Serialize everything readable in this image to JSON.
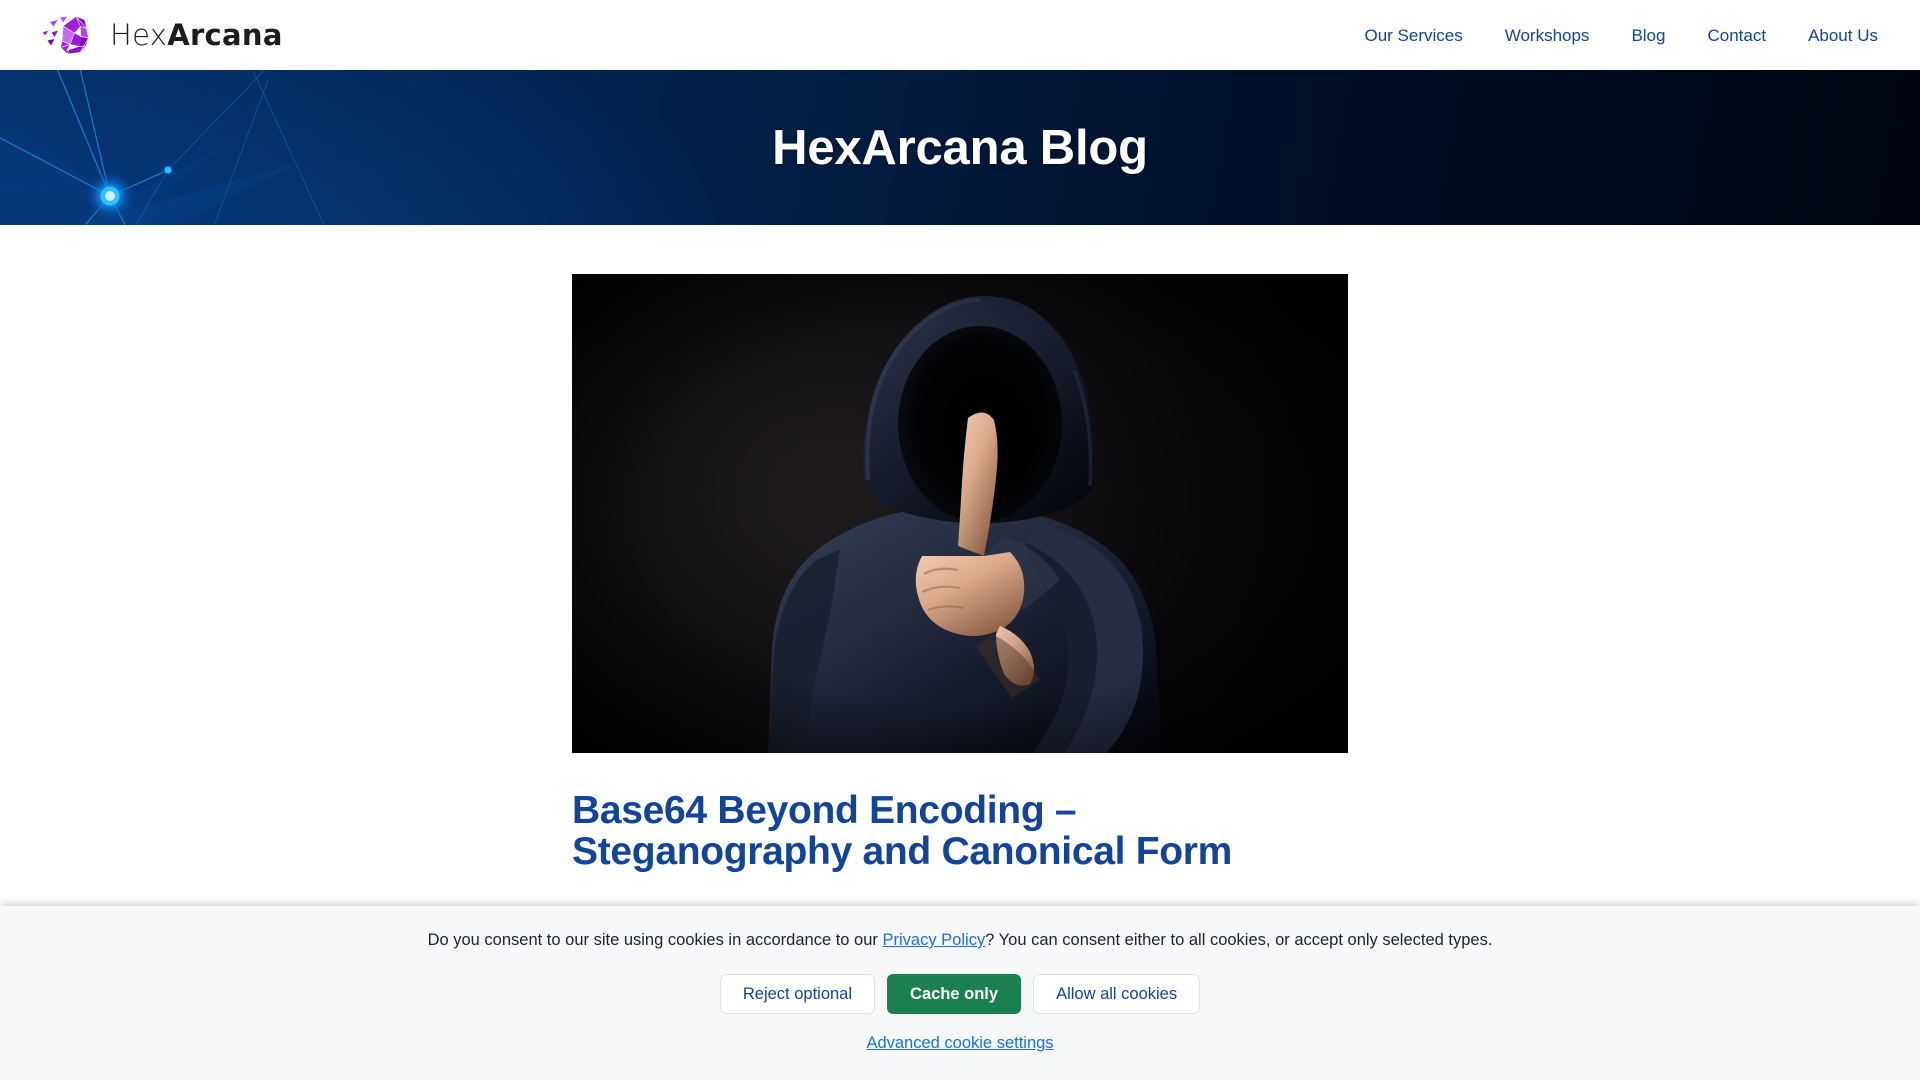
{
  "header": {
    "logo": {
      "icon": "hexarcana-polygon-logo",
      "word_part1": "Hex",
      "word_part2": "Arcana"
    },
    "nav": [
      {
        "label": "Our Services"
      },
      {
        "label": "Workshops"
      },
      {
        "label": "Blog"
      },
      {
        "label": "Contact"
      },
      {
        "label": "About Us"
      }
    ]
  },
  "hero": {
    "title": "HexArcana Blog",
    "decoration": "network-nodes-graphic"
  },
  "article": {
    "image_alt": "hooded-figure-shh-gesture",
    "title_lines": [
      "Base64 Beyond Encoding –",
      "Steganography and Canonical Form"
    ]
  },
  "cookie_banner": {
    "text_before_link": "Do you consent to our site using cookies in accordance to our ",
    "link_label": "Privacy Policy",
    "text_after_link": "? You can consent either to all cookies, or accept only selected types.",
    "reject_label": "Reject optional",
    "cache_label": "Cache only",
    "allow_label": "Allow all cookies",
    "advanced_label": "Advanced cookie settings"
  },
  "colors": {
    "brand_blue": "#12449b",
    "link_blue": "#1b6ef3",
    "primary_green": "#1a8052",
    "logo_purple": "#9b18dd",
    "hero_dark": "#00060f",
    "banner_bg": "#f7f8fa"
  }
}
